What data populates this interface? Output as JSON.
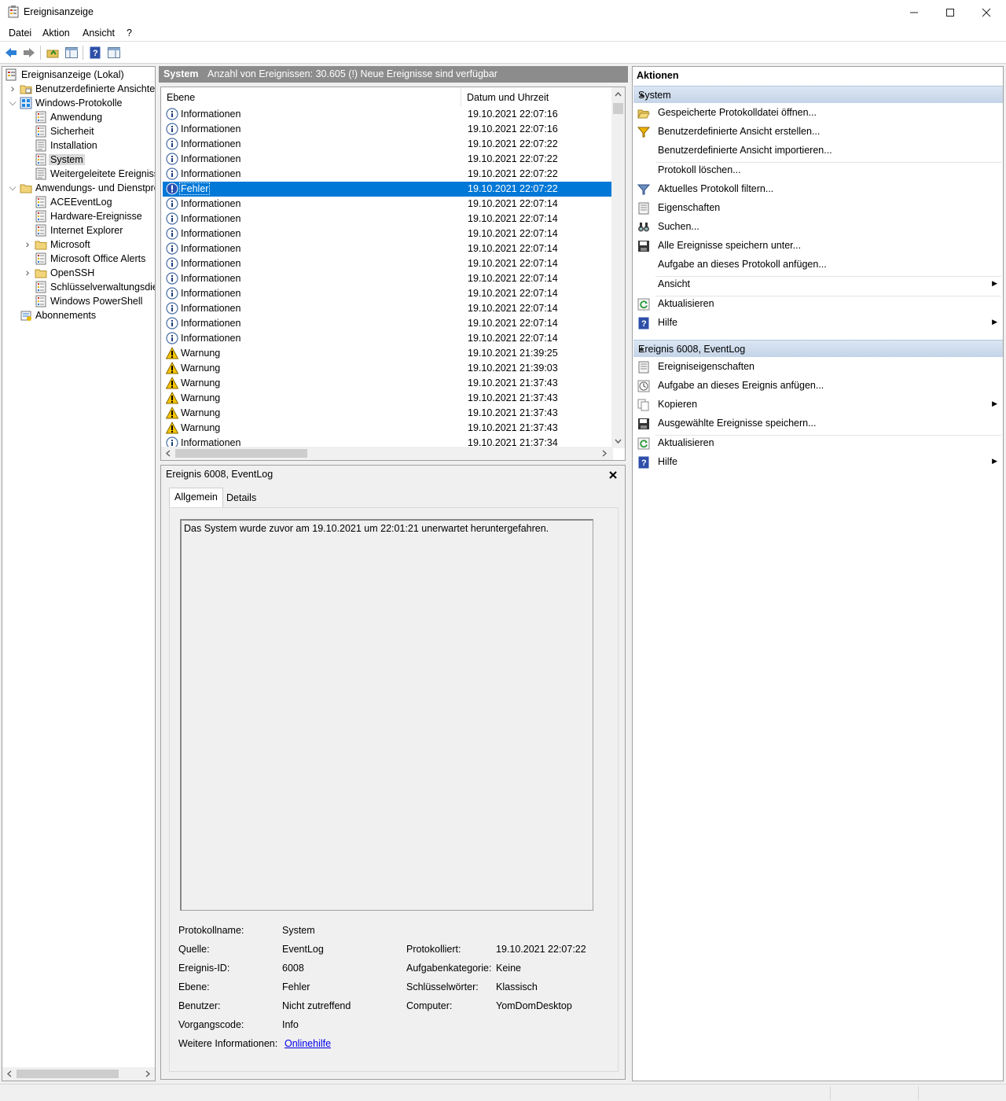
{
  "window": {
    "title": "Ereignisanzeige",
    "controls": [
      "minimize",
      "maximize",
      "close"
    ]
  },
  "menu": [
    "Datei",
    "Aktion",
    "Ansicht",
    "?"
  ],
  "toolbar": {
    "icons": [
      "back-arrow-icon",
      "forward-arrow-icon",
      "up-folder-icon",
      "show-hide-tree-icon",
      "help-icon",
      "show-hide-actions-icon"
    ]
  },
  "tree": {
    "items": [
      {
        "label": "Ereignisanzeige (Lokal)",
        "depth": 0,
        "expander": ""
      },
      {
        "label": "Benutzerdefinierte Ansichten",
        "depth": 1,
        "expander": "collapsed"
      },
      {
        "label": "Windows-Protokolle",
        "depth": 1,
        "expander": "expanded"
      },
      {
        "label": "Anwendung",
        "depth": 2,
        "expander": ""
      },
      {
        "label": "Sicherheit",
        "depth": 2,
        "expander": ""
      },
      {
        "label": "Installation",
        "depth": 2,
        "expander": ""
      },
      {
        "label": "System",
        "depth": 2,
        "expander": "",
        "selected": true
      },
      {
        "label": "Weitergeleitete Ereignisse",
        "depth": 2,
        "expander": ""
      },
      {
        "label": "Anwendungs- und Dienstprotokolle",
        "depth": 1,
        "expander": "expanded"
      },
      {
        "label": "ACEEventLog",
        "depth": 2,
        "expander": ""
      },
      {
        "label": "Hardware-Ereignisse",
        "depth": 2,
        "expander": ""
      },
      {
        "label": "Internet Explorer",
        "depth": 2,
        "expander": ""
      },
      {
        "label": "Microsoft",
        "depth": 2,
        "expander": "collapsed"
      },
      {
        "label": "Microsoft Office Alerts",
        "depth": 2,
        "expander": ""
      },
      {
        "label": "OpenSSH",
        "depth": 2,
        "expander": "collapsed"
      },
      {
        "label": "Schlüsselverwaltungsdienst",
        "depth": 2,
        "expander": ""
      },
      {
        "label": "Windows PowerShell",
        "depth": 2,
        "expander": ""
      },
      {
        "label": "Abonnements",
        "depth": 1,
        "expander": ""
      }
    ]
  },
  "events_header": {
    "log_name": "System",
    "count_text": "Anzahl von Ereignissen: 30.605 (!) Neue Ereignisse sind verfügbar"
  },
  "events_table": {
    "columns": [
      "Ebene",
      "Datum und Uhrzeit"
    ],
    "rows": [
      {
        "level": "Informationen",
        "type": "info",
        "datetime": "19.10.2021 22:07:16"
      },
      {
        "level": "Informationen",
        "type": "info",
        "datetime": "19.10.2021 22:07:16"
      },
      {
        "level": "Informationen",
        "type": "info",
        "datetime": "19.10.2021 22:07:22"
      },
      {
        "level": "Informationen",
        "type": "info",
        "datetime": "19.10.2021 22:07:22"
      },
      {
        "level": "Informationen",
        "type": "info",
        "datetime": "19.10.2021 22:07:22"
      },
      {
        "level": "Fehler",
        "type": "error",
        "datetime": "19.10.2021 22:07:22",
        "selected": true
      },
      {
        "level": "Informationen",
        "type": "info",
        "datetime": "19.10.2021 22:07:14"
      },
      {
        "level": "Informationen",
        "type": "info",
        "datetime": "19.10.2021 22:07:14"
      },
      {
        "level": "Informationen",
        "type": "info",
        "datetime": "19.10.2021 22:07:14"
      },
      {
        "level": "Informationen",
        "type": "info",
        "datetime": "19.10.2021 22:07:14"
      },
      {
        "level": "Informationen",
        "type": "info",
        "datetime": "19.10.2021 22:07:14"
      },
      {
        "level": "Informationen",
        "type": "info",
        "datetime": "19.10.2021 22:07:14"
      },
      {
        "level": "Informationen",
        "type": "info",
        "datetime": "19.10.2021 22:07:14"
      },
      {
        "level": "Informationen",
        "type": "info",
        "datetime": "19.10.2021 22:07:14"
      },
      {
        "level": "Informationen",
        "type": "info",
        "datetime": "19.10.2021 22:07:14"
      },
      {
        "level": "Informationen",
        "type": "info",
        "datetime": "19.10.2021 22:07:14"
      },
      {
        "level": "Warnung",
        "type": "warning",
        "datetime": "19.10.2021 21:39:25"
      },
      {
        "level": "Warnung",
        "type": "warning",
        "datetime": "19.10.2021 21:39:03"
      },
      {
        "level": "Warnung",
        "type": "warning",
        "datetime": "19.10.2021 21:37:43"
      },
      {
        "level": "Warnung",
        "type": "warning",
        "datetime": "19.10.2021 21:37:43"
      },
      {
        "level": "Warnung",
        "type": "warning",
        "datetime": "19.10.2021 21:37:43"
      },
      {
        "level": "Warnung",
        "type": "warning",
        "datetime": "19.10.2021 21:37:43"
      },
      {
        "level": "Informationen",
        "type": "info",
        "datetime": "19.10.2021 21:37:34"
      }
    ]
  },
  "event_detail": {
    "title": "Ereignis 6008, EventLog",
    "tabs": [
      "Allgemein",
      "Details"
    ],
    "active_tab": "Allgemein",
    "message": "Das System wurde zuvor am 19.10.2021 um 22:01:21 unerwartet heruntergefahren.",
    "fields": {
      "protokollname_label": "Protokollname:",
      "protokollname": "System",
      "quelle_label": "Quelle:",
      "quelle": "EventLog",
      "protokolliert_label": "Protokolliert:",
      "protokolliert": "19.10.2021 22:07:22",
      "ereignis_id_label": "Ereignis-ID:",
      "ereignis_id": "6008",
      "aufgabenkategorie_label": "Aufgabenkategorie:",
      "aufgabenkategorie": "Keine",
      "ebene_label": "Ebene:",
      "ebene": "Fehler",
      "schluesselwoerter_label": "Schlüsselwörter:",
      "schluesselwoerter": "Klassisch",
      "benutzer_label": "Benutzer:",
      "benutzer": "Nicht zutreffend",
      "computer_label": "Computer:",
      "computer": "YomDomDesktop",
      "vorgangscode_label": "Vorgangscode:",
      "vorgangscode": "Info",
      "weitere_label": "Weitere Informationen:",
      "weitere_link": "Onlinehilfe"
    }
  },
  "actions": {
    "title": "Aktionen",
    "sections": [
      {
        "header": "System",
        "items": [
          {
            "label": "Gespeicherte Protokolldatei öffnen...",
            "icon": "open-folder-icon",
            "submenu": false
          },
          {
            "label": "Benutzerdefinierte Ansicht erstellen...",
            "icon": "filter-create-icon",
            "submenu": false
          },
          {
            "label": "Benutzerdefinierte Ansicht importieren...",
            "icon": "",
            "submenu": false
          },
          {
            "label": "Protokoll löschen...",
            "icon": "",
            "submenu": false,
            "sep_before": true
          },
          {
            "label": "Aktuelles Protokoll filtern...",
            "icon": "filter-icon",
            "submenu": false
          },
          {
            "label": "Eigenschaften",
            "icon": "properties-icon",
            "submenu": false
          },
          {
            "label": "Suchen...",
            "icon": "binoculars-icon",
            "submenu": false
          },
          {
            "label": "Alle Ereignisse speichern unter...",
            "icon": "save-icon",
            "submenu": false
          },
          {
            "label": "Aufgabe an dieses Protokoll anfügen...",
            "icon": "",
            "submenu": false
          },
          {
            "label": "Ansicht",
            "icon": "",
            "submenu": true,
            "sep_before": true
          },
          {
            "label": "Aktualisieren",
            "icon": "refresh-icon",
            "submenu": false,
            "sep_before": true
          },
          {
            "label": "Hilfe",
            "icon": "help-icon",
            "submenu": true
          }
        ]
      },
      {
        "header": "Ereignis 6008, EventLog",
        "items": [
          {
            "label": "Ereigniseigenschaften",
            "icon": "event-properties-icon",
            "submenu": false
          },
          {
            "label": "Aufgabe an dieses Ereignis anfügen...",
            "icon": "task-icon",
            "submenu": false
          },
          {
            "label": "Kopieren",
            "icon": "copy-icon",
            "submenu": true
          },
          {
            "label": "Ausgewählte Ereignisse speichern...",
            "icon": "save-icon",
            "submenu": false
          },
          {
            "label": "Aktualisieren",
            "icon": "refresh-icon",
            "submenu": false,
            "sep_before": true
          },
          {
            "label": "Hilfe",
            "icon": "help-icon",
            "submenu": true
          }
        ]
      }
    ]
  },
  "colors": {
    "selection": "#0078d7",
    "pane_header": "#8c8c8c",
    "action_section": "#c4d4e7",
    "link": "#0000ee"
  }
}
